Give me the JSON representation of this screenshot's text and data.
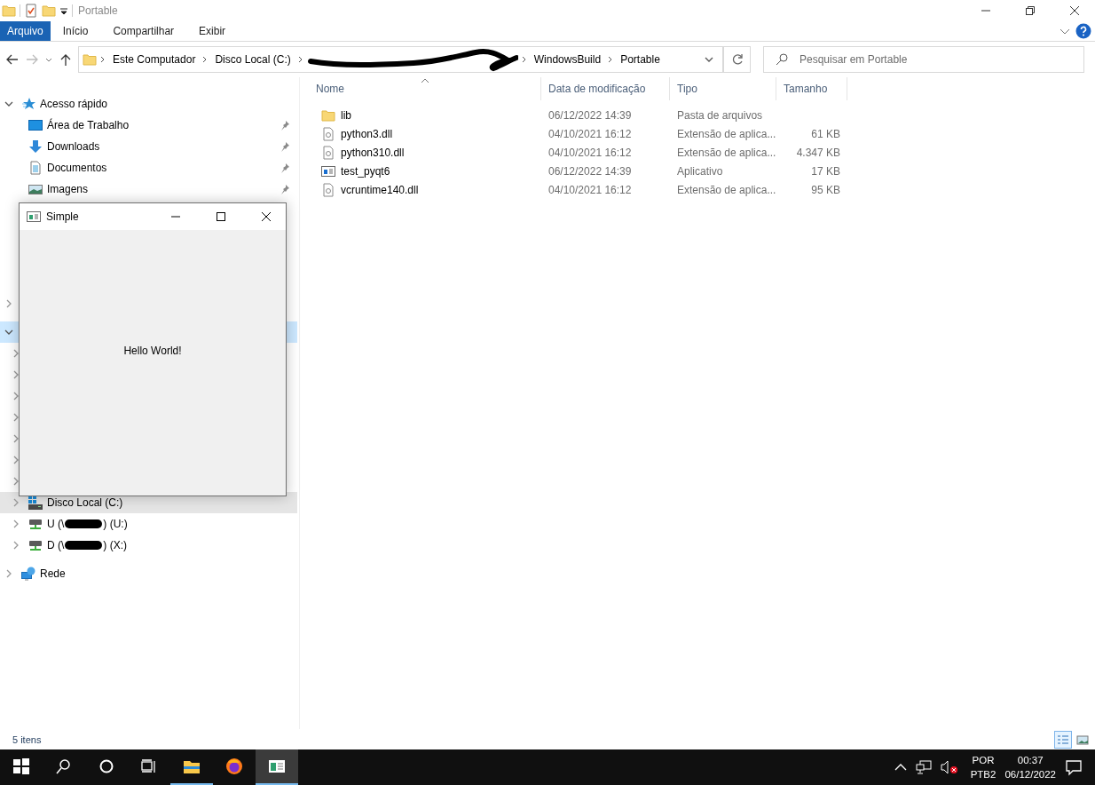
{
  "window": {
    "title": "Portable"
  },
  "ribbon": {
    "tabs": [
      {
        "label": "Arquivo",
        "kind": "file"
      },
      {
        "label": "Início",
        "kind": "tab"
      },
      {
        "label": "Compartilhar",
        "kind": "tab"
      },
      {
        "label": "Exibir",
        "kind": "tab"
      }
    ]
  },
  "address": {
    "crumbs": [
      {
        "kind": "text",
        "label": "Este Computador"
      },
      {
        "kind": "text",
        "label": "Disco Local (C:)"
      },
      {
        "kind": "redacted"
      },
      {
        "kind": "text",
        "label": "WindowsBuild"
      },
      {
        "kind": "text",
        "label": "Portable"
      }
    ]
  },
  "search": {
    "placeholder": "Pesquisar em Portable"
  },
  "sidebar": {
    "groups": [
      [
        {
          "label": "Acesso rápido",
          "kind": "star",
          "expanded": true,
          "selected": false,
          "hovered": false,
          "children": [
            {
              "label": "Área de Trabalho",
              "kind": "desktop",
              "pinned": true,
              "selected": false,
              "hovered": false
            },
            {
              "label": "Downloads",
              "kind": "download",
              "pinned": true,
              "selected": false,
              "hovered": false
            },
            {
              "label": "Documentos",
              "kind": "document",
              "pinned": true,
              "selected": false,
              "hovered": false
            },
            {
              "label": "Imagens",
              "kind": "image",
              "pinned": true,
              "selected": false,
              "hovered": false
            }
          ]
        }
      ],
      [
        {
          "expanded": false,
          "selected": false,
          "hovered": false
        }
      ],
      [
        {
          "expanded": true,
          "selected": true,
          "hovered": false,
          "children": [
            {
              "expanded": false,
              "selected": false,
              "hovered": false
            },
            {
              "expanded": false,
              "selected": false,
              "hovered": false
            },
            {
              "expanded": false,
              "selected": false,
              "hovered": false
            },
            {
              "expanded": false,
              "selected": false,
              "hovered": false
            },
            {
              "expanded": false,
              "selected": false,
              "hovered": false
            },
            {
              "expanded": false,
              "selected": false,
              "hovered": false
            },
            {
              "expanded": false,
              "selected": false,
              "hovered": false
            },
            {
              "label": "Disco Local (C:)",
              "kind": "disk",
              "expanded": false,
              "selected": false,
              "hovered": true
            },
            {
              "label_parts": [
                "U (\\",
                ") (U:)"
              ],
              "kind": "netdrive",
              "expanded": false,
              "selected": false,
              "hovered": false
            },
            {
              "label_parts": [
                "D (\\",
                ") (X:)"
              ],
              "kind": "netdrive",
              "expanded": false,
              "selected": false,
              "hovered": false
            }
          ]
        }
      ],
      [
        {
          "label": "Rede",
          "kind": "network",
          "expanded": false,
          "selected": false,
          "hovered": false
        }
      ]
    ]
  },
  "table": {
    "columns": [
      {
        "label": "Nome",
        "sorted": true
      },
      {
        "label": "Data de modificação",
        "sorted": false
      },
      {
        "label": "Tipo",
        "sorted": false
      },
      {
        "label": "Tamanho",
        "sorted": false
      }
    ],
    "rows": [
      {
        "kind": "folder",
        "name": "lib",
        "modified": "06/12/2022 14:39",
        "type": "Pasta de arquivos"
      },
      {
        "kind": "dll",
        "name": "python3.dll",
        "modified": "04/10/2021 16:12",
        "type": "Extensão de aplica...",
        "size": "61 KB"
      },
      {
        "kind": "dll",
        "name": "python310.dll",
        "modified": "04/10/2021 16:12",
        "type": "Extensão de aplica...",
        "size": "4.347 KB"
      },
      {
        "kind": "exe",
        "name": "test_pyqt6",
        "modified": "06/12/2022 14:39",
        "type": "Aplicativo",
        "size": "17 KB"
      },
      {
        "kind": "dll",
        "name": "vcruntime140.dll",
        "modified": "04/10/2021 16:12",
        "type": "Extensão de aplica...",
        "size": "95 KB"
      }
    ]
  },
  "status_bar": {
    "count": "5 itens",
    "views": [
      {
        "kind": "details",
        "selected": true
      },
      {
        "kind": "tiles",
        "selected": false
      }
    ]
  },
  "dialog": {
    "title": "Simple",
    "message": "Hello World!"
  },
  "taskbar": {
    "apps": [
      {
        "kind": "explorer",
        "running": true,
        "selected": false
      },
      {
        "kind": "firefox",
        "running": false,
        "selected": false
      },
      {
        "kind": "app",
        "running": true,
        "selected": true
      }
    ],
    "language": "POR",
    "layout": "PTB2",
    "time": "00:37",
    "date": "06/12/2022"
  }
}
